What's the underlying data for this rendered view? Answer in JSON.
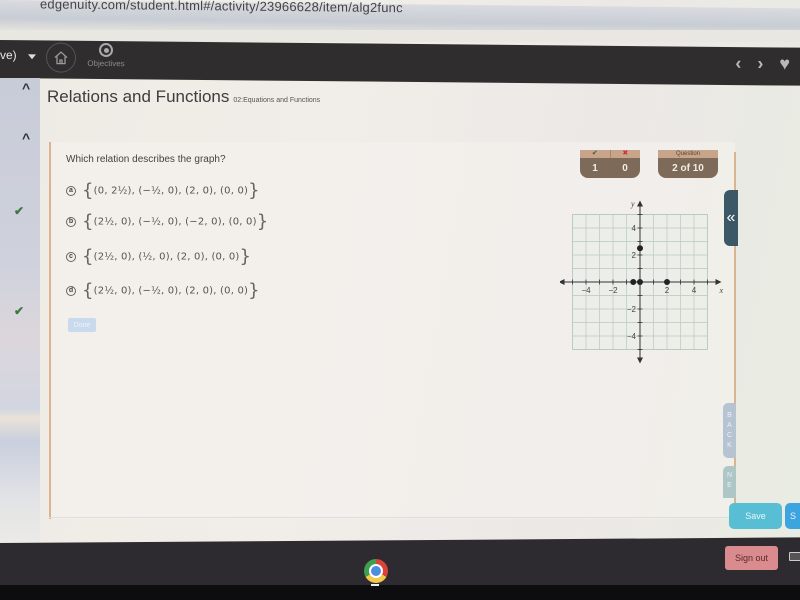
{
  "browser": {
    "url": "edgenuity.com/student.html#/activity/23966628/item/alg2func"
  },
  "topnav": {
    "user_label": "ve)",
    "home_icon": "home-icon",
    "objectives_label": "Objectives",
    "objectives_icon": "target-icon",
    "prev_icon": "‹",
    "next_icon": "›",
    "favorite_icon": "♥"
  },
  "sidebar": {
    "collapse_icons": [
      "^",
      "^"
    ],
    "completed_checks": [
      "✔",
      "✔"
    ]
  },
  "header": {
    "title": "Relations and Functions",
    "subtitle": "02:Equations and Functions"
  },
  "question": {
    "prompt": "Which relation describes the graph?",
    "options": [
      {
        "letter": "a",
        "pairs": [
          "(0, 2½)",
          "(−½, 0)",
          "(2, 0)",
          "(0, 0)"
        ]
      },
      {
        "letter": "b",
        "pairs": [
          "(2½, 0)",
          "(−½, 0)",
          "(−2, 0)",
          "(0, 0)"
        ]
      },
      {
        "letter": "c",
        "pairs": [
          "(2½, 0)",
          "(½, 0)",
          "(2, 0)",
          "(0, 0)"
        ]
      },
      {
        "letter": "d",
        "pairs": [
          "(2½, 0)",
          "(−½, 0)",
          "(2, 0)",
          "(0, 0)"
        ]
      }
    ],
    "done_label": "Done"
  },
  "score": {
    "correct_icon": "✔",
    "incorrect_icon": "✖",
    "correct": "1",
    "incorrect": "0",
    "question_header": "Question",
    "question_progress": "2 of 10"
  },
  "graph": {
    "x_label": "x",
    "y_label": "y",
    "range": [
      -5,
      5
    ],
    "x_ticks": [
      "−4",
      "−2",
      "2",
      "4"
    ],
    "y_ticks": [
      "4",
      "2",
      "−2",
      "−4"
    ],
    "points": [
      [
        0,
        2.5
      ],
      [
        -0.5,
        0
      ],
      [
        0,
        0
      ],
      [
        2,
        0
      ]
    ]
  },
  "side_tabs": {
    "collapse_icon": "«",
    "back_label": [
      "B",
      "A",
      "C",
      "K"
    ],
    "next_label": [
      "N",
      "E"
    ]
  },
  "footer": {
    "save_label": "Save",
    "submit_label": "S"
  },
  "taskbar": {
    "sign_out_label": "Sign out"
  }
}
